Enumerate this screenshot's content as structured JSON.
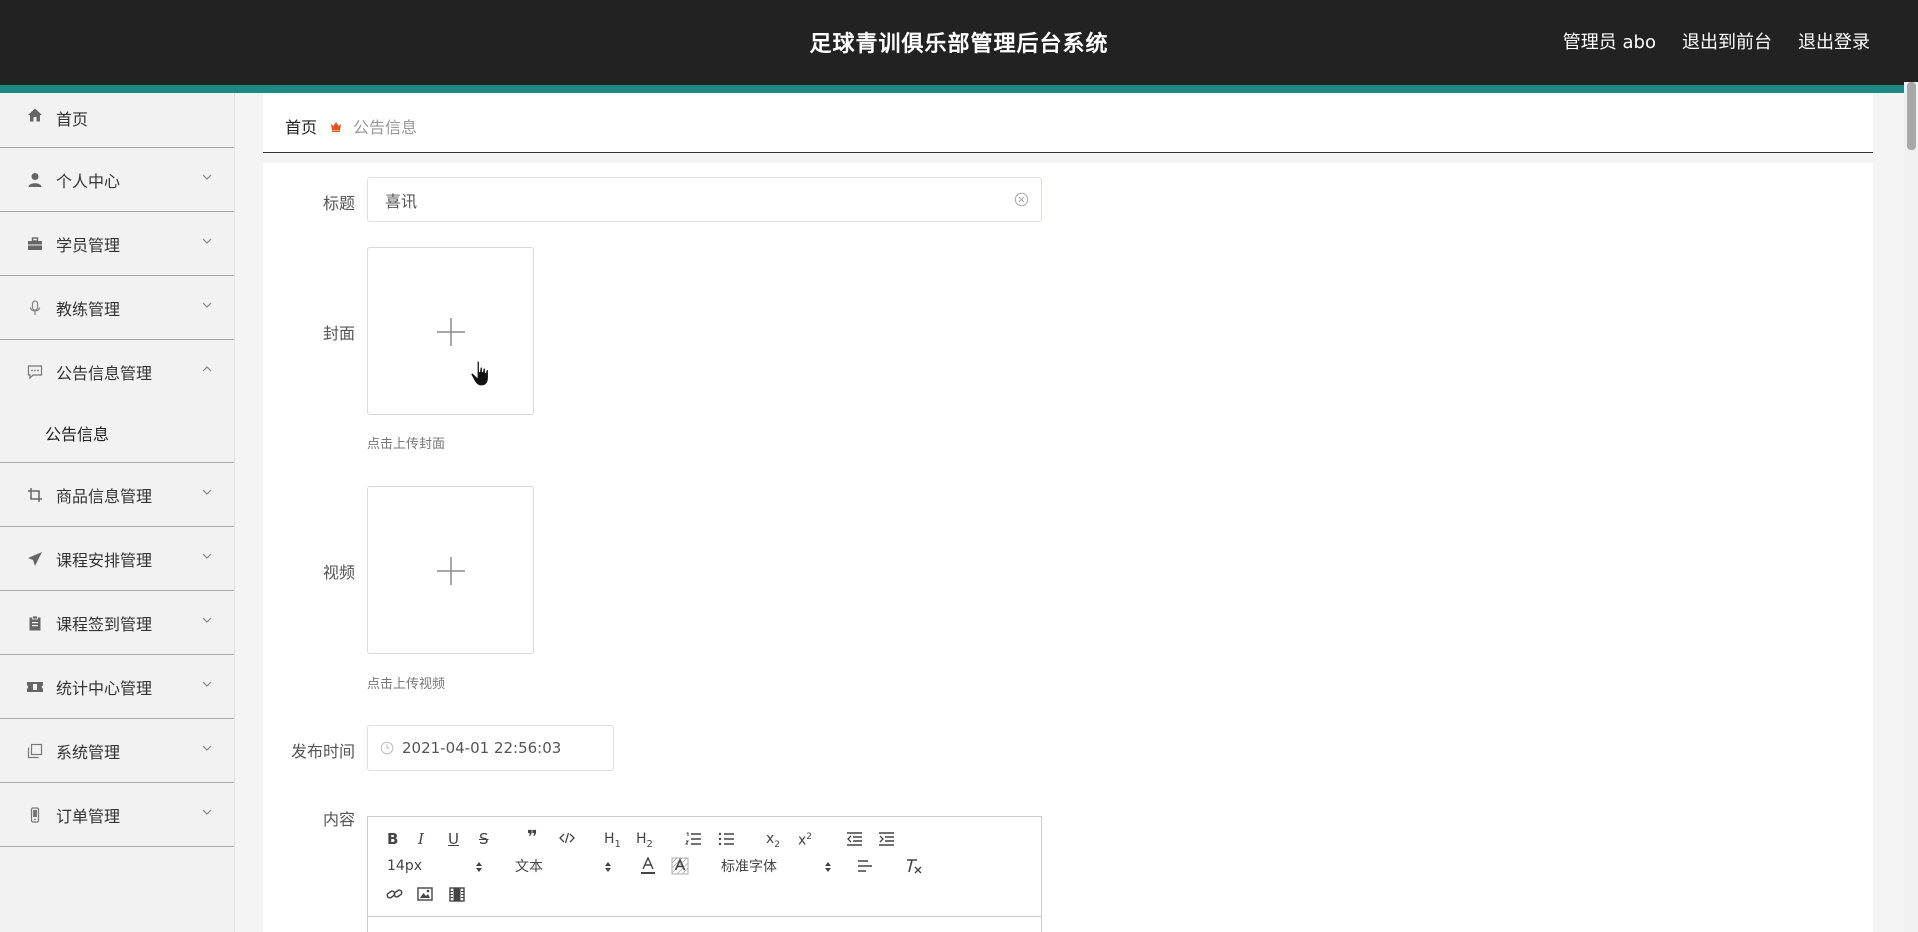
{
  "header": {
    "title": "足球青训俱乐部管理后台系统",
    "user_label": "管理员 abo",
    "front_link": "退出到前台",
    "logout_link": "退出登录"
  },
  "sidebar": {
    "items": [
      {
        "label": "首页",
        "icon": "home-icon"
      },
      {
        "label": "个人中心",
        "icon": "user-icon"
      },
      {
        "label": "学员管理",
        "icon": "briefcase-icon"
      },
      {
        "label": "教练管理",
        "icon": "microphone-icon"
      },
      {
        "label": "公告信息管理",
        "icon": "chat-icon",
        "expanded": true,
        "children": [
          {
            "label": "公告信息"
          }
        ]
      },
      {
        "label": "商品信息管理",
        "icon": "crop-icon"
      },
      {
        "label": "课程安排管理",
        "icon": "send-icon"
      },
      {
        "label": "课程签到管理",
        "icon": "clipboard-icon"
      },
      {
        "label": "统计中心管理",
        "icon": "ticket-icon"
      },
      {
        "label": "系统管理",
        "icon": "copy-icon"
      },
      {
        "label": "订单管理",
        "icon": "phone-icon"
      }
    ]
  },
  "breadcrumb": {
    "home": "首页",
    "current": "公告信息"
  },
  "form": {
    "title_label": "标题",
    "title_value": "喜讯",
    "cover_label": "封面",
    "cover_tip": "点击上传封面",
    "video_label": "视频",
    "video_tip": "点击上传视频",
    "publish_time_label": "发布时间",
    "publish_time_value": "2021-04-01 22:56:03",
    "content_label": "内容"
  },
  "editor": {
    "font_size": "14px",
    "header_select": "文本",
    "font_family": "标准字体"
  },
  "colors": {
    "header_bg": "#222222",
    "accent": "#1c8a83",
    "breadcrumb_separator": "#e8501c"
  }
}
